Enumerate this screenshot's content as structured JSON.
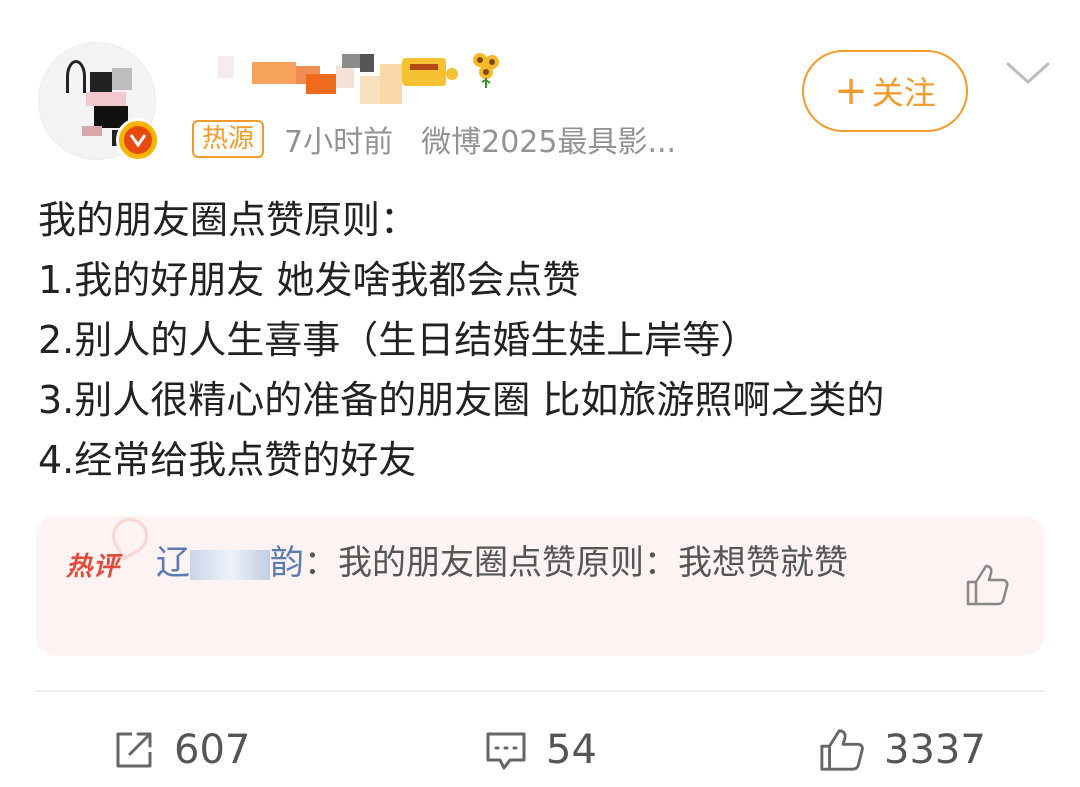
{
  "header": {
    "source_tag": "热源",
    "time": "7小时前",
    "source_desc": "微博2025最具影...",
    "follow_label": "关注",
    "follow_plus": "+"
  },
  "post": {
    "lines": [
      "我的朋友圈点赞原则：",
      "1.我的好朋友 她发啥我都会点赞",
      "2.别人的人生喜事（生日结婚生娃上岸等）",
      "3.别人很精心的准备的朋友圈 比如旅游照啊之类的",
      "4.经常给我点赞的好友"
    ]
  },
  "hot_comment": {
    "logo": "热评",
    "author_prefix": "辽",
    "author_suffix": "韵",
    "separator": "：",
    "text": "我的朋友圈点赞原则：我想赞就赞"
  },
  "actions": {
    "share_count": "607",
    "comment_count": "54",
    "like_count": "3337"
  },
  "colors": {
    "accent": "#f39b2a",
    "hot_red": "#e24a3b",
    "link_blue": "#5b7bb5"
  },
  "icons": {
    "avatar_badge": "verified-v-icon",
    "more": "chevron-down-icon",
    "share": "share-icon",
    "comment": "comment-icon",
    "like": "thumbs-up-icon"
  }
}
